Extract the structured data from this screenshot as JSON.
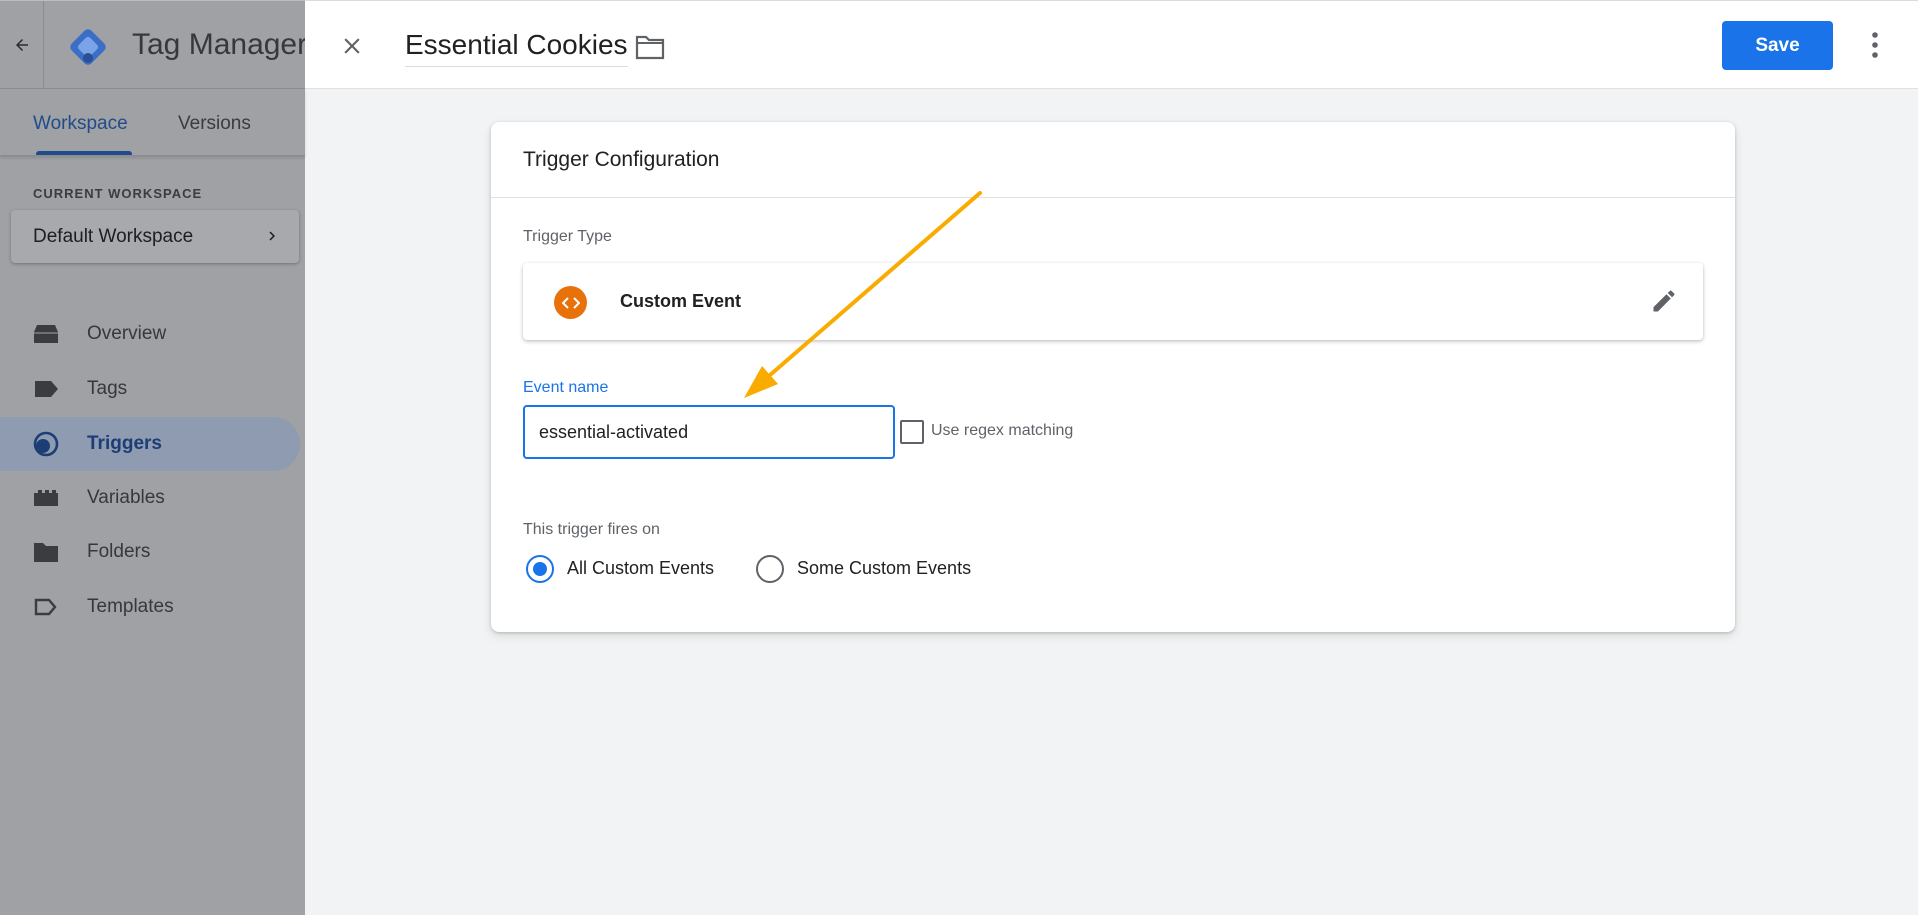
{
  "app": {
    "title": "Tag Manager"
  },
  "sidebar": {
    "tabs": [
      {
        "label": "Workspace"
      },
      {
        "label": "Versions"
      }
    ],
    "current_workspace_label": "CURRENT WORKSPACE",
    "workspace_name": "Default Workspace",
    "items": [
      {
        "label": "Overview",
        "icon": "overview-icon"
      },
      {
        "label": "Tags",
        "icon": "tag-icon"
      },
      {
        "label": "Triggers",
        "icon": "trigger-icon",
        "active": true
      },
      {
        "label": "Variables",
        "icon": "variables-icon"
      },
      {
        "label": "Folders",
        "icon": "folder-icon"
      },
      {
        "label": "Templates",
        "icon": "template-icon"
      }
    ]
  },
  "editor": {
    "name": "Essential Cookies",
    "save_label": "Save"
  },
  "config": {
    "title": "Trigger Configuration",
    "trigger_type_label": "Trigger Type",
    "trigger_type": "Custom Event",
    "event_name_label": "Event name",
    "event_name_value": "essential-activated",
    "regex_label": "Use regex matching",
    "regex_checked": false,
    "fires_on_label": "This trigger fires on",
    "fires_options": [
      {
        "label": "All Custom Events",
        "selected": true
      },
      {
        "label": "Some Custom Events",
        "selected": false
      }
    ]
  },
  "colors": {
    "accent": "#1a73e8",
    "custom_event_icon": "#e8710a",
    "annotation_arrow": "#f9ab00",
    "sidebar_overlay": "#9fa1a4"
  }
}
